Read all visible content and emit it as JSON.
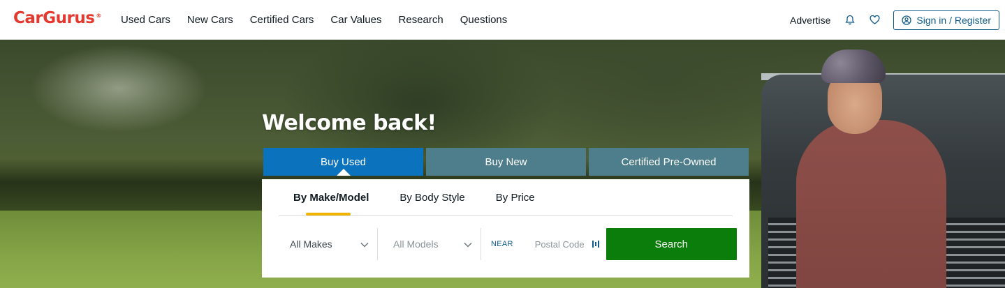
{
  "header": {
    "logo": "CarGurus",
    "logo_mark": "®",
    "nav": [
      "Used Cars",
      "New Cars",
      "Certified Cars",
      "Car Values",
      "Research",
      "Questions"
    ],
    "advertise": "Advertise",
    "signin": "Sign in / Register",
    "icons": [
      "bell-icon",
      "heart-icon",
      "user-circle-icon"
    ]
  },
  "hero": {
    "welcome": "Welcome back!",
    "tabs": [
      "Buy Used",
      "Buy New",
      "Certified Pre-Owned"
    ],
    "active_tab": "Buy Used",
    "subtabs": [
      "By Make/Model",
      "By Body Style",
      "By Price"
    ],
    "active_subtab": "By Make/Model",
    "makes_select": "All Makes",
    "models_select": "All Models",
    "near_label": "NEAR",
    "postal_placeholder": "Postal Code",
    "search_button": "Search"
  },
  "colors": {
    "brand_red": "#e3392f",
    "active_tab": "#0b72bd",
    "inactive_tab": "#4e7d8b",
    "search_green": "#0b7d0b",
    "accent_underline": "#f0b400",
    "signin_blue": "#0e5a8a"
  }
}
